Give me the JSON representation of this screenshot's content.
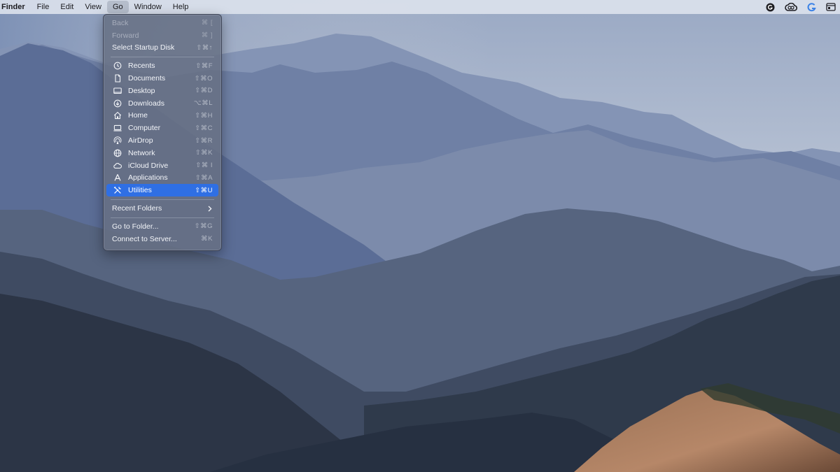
{
  "menubar": {
    "app_name": "Finder",
    "menus": [
      "File",
      "Edit",
      "View",
      "Go",
      "Window",
      "Help"
    ],
    "active_menu": "Go",
    "status_icons": [
      "grammarly-icon",
      "creative-cloud-icon",
      "g-app-icon",
      "window-icon"
    ]
  },
  "go_menu": {
    "nav": [
      {
        "label": "Back",
        "shortcut": "⌘ [",
        "enabled": false
      },
      {
        "label": "Forward",
        "shortcut": "⌘ ]",
        "enabled": false
      },
      {
        "label": "Select Startup Disk",
        "shortcut": "⇧⌘↑",
        "enabled": true
      }
    ],
    "places": [
      {
        "label": "Recents",
        "shortcut": "⇧⌘F",
        "icon": "clock-icon"
      },
      {
        "label": "Documents",
        "shortcut": "⇧⌘O",
        "icon": "document-icon"
      },
      {
        "label": "Desktop",
        "shortcut": "⇧⌘D",
        "icon": "desktop-icon"
      },
      {
        "label": "Downloads",
        "shortcut": "⌥⌘L",
        "icon": "download-icon"
      },
      {
        "label": "Home",
        "shortcut": "⇧⌘H",
        "icon": "home-icon"
      },
      {
        "label": "Computer",
        "shortcut": "⇧⌘C",
        "icon": "computer-icon"
      },
      {
        "label": "AirDrop",
        "shortcut": "⇧⌘R",
        "icon": "airdrop-icon"
      },
      {
        "label": "Network",
        "shortcut": "⇧⌘K",
        "icon": "globe-icon"
      },
      {
        "label": "iCloud Drive",
        "shortcut": "⇧⌘ I",
        "icon": "cloud-icon"
      },
      {
        "label": "Applications",
        "shortcut": "⇧⌘A",
        "icon": "applications-icon"
      },
      {
        "label": "Utilities",
        "shortcut": "⇧⌘U",
        "icon": "tools-icon",
        "selected": true
      }
    ],
    "recent_folders": {
      "label": "Recent Folders"
    },
    "folder_actions": [
      {
        "label": "Go to Folder...",
        "shortcut": "⇧⌘G"
      },
      {
        "label": "Connect to Server...",
        "shortcut": "⌘K"
      }
    ]
  },
  "colors": {
    "selection": "#2f6fe4",
    "menu_background": "#667084",
    "menubar_background": "#dee4ee"
  }
}
